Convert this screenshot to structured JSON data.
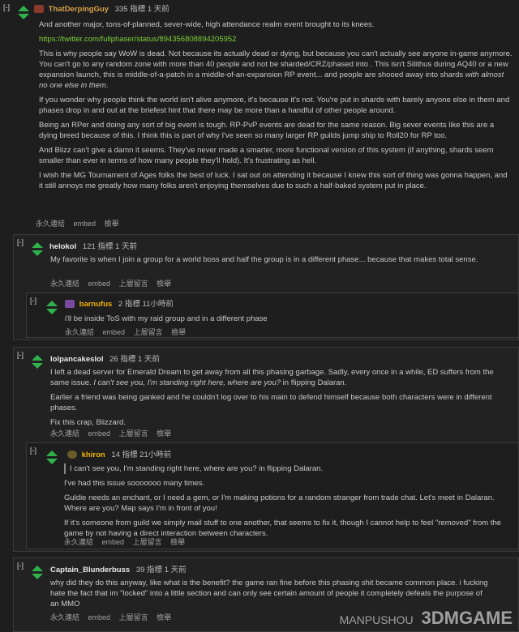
{
  "comments": {
    "top": {
      "collapse": "[-]",
      "author": "ThatDerpingGuy",
      "points": "335 指標",
      "time": "1 天前",
      "p1": "And another major, tons-of-planned, sever-wide, high attendance realm event brought to its knees.",
      "link": "https://twitter.com/fullphaser/status/894356808894205952",
      "p2a": "This is why people say WoW is dead. Not because its actually dead or dying, but because you can't actually see anyone in-game anymore. You can't go to any random zone with more than 40 people and not be sharded/CRZ/phased into . This isn't Silithus during AQ40 or a new expansion launch, this is middle-of-a-patch in a middle-of-an-expansion RP event... and people are shooed away into shards ",
      "p2em": "with almost no one else in them",
      "p2b": ".",
      "p3": "If you wonder why people think the world isn't alive anymore, it's because it's not. You're put in shards with barely anyone else in them and phases drop in and out at the briefest hint that there may be more than a handful of other people around.",
      "p4": "Being an RPer and doing any sort of big event is tough. RP-PvP events are dead for the same reason. Big sever events like this are a dying breed because of this. I think this is part of why I've seen so many larger RP guilds jump ship to Roll20 for RP too.",
      "p5": "And Blizz can't give a damn it seems. They've never made a smarter, more functional version of this system (if anything, shards seem smaller than ever in terms of how many people they'll hold). It's frustrating as hell.",
      "p6": "I wish the MG Tournament of Ages folks the best of luck. I sat out on attending it because I knew this sort of thing was gonna happen, and it still annoys me greatly how many folks aren't enjoying themselves due to such a half-baked system put in place.",
      "actions": [
        "永久連結",
        "embed",
        "檢舉"
      ]
    },
    "helokol": {
      "collapse": "[-]",
      "author": "helokol",
      "points": "121 指標",
      "time": "1 天前",
      "p1": "My favorite is when I join a group for a world boss and half the group is in a different phase... because that makes total sense.",
      "actions": [
        "永久連結",
        "embed",
        "上層留言",
        "檢舉"
      ]
    },
    "barnufus": {
      "collapse": "[-]",
      "author": "barnufus",
      "points": "2 指標",
      "time": "11小時前",
      "p1": "i'll be inside ToS with my raid group and in a different phase",
      "actions": [
        "永久連結",
        "embed",
        "上層留言",
        "檢舉"
      ]
    },
    "lol": {
      "collapse": "[-]",
      "author": "lolpancakeslol",
      "points": "26 指標",
      "time": "1 天前",
      "p1": "I left a dead server for Emerald Dream to get away from all this phasing garbage. Sadly, every once in a while, ED suffers from the same issue. ",
      "p1em": "I can't see you, I'm standing right here, where are you?",
      "p1b": " in flipping Dalaran.",
      "p2": "Earlier a friend was being ganked and he couldn't log over to his main to defend himself because both characters were in different phases.",
      "p3": "Fix this crap, Blizzard.",
      "actions": [
        "永久連結",
        "embed",
        "上層留言",
        "檢舉"
      ]
    },
    "khiron": {
      "collapse": "[-]",
      "author": "khiron",
      "points": "14 指標",
      "time": "21小時前",
      "quote": "I can't see you, I'm standing right here, where are you? in flipping Dalaran.",
      "p1": "I've had this issue sooooooo many times.",
      "p2": "Guldie needs an enchant, or I need a gem, or I'm making potions for a random stranger from trade chat. Let's meet in Dalaran. Where are you? Map says I'm in front of you!",
      "p3": "If it's someone from guild we simply mail stuff to one another, that seems to fix it, though I cannot help to feel \"removed\" from the game by not having a direct interaction between characters.",
      "actions": [
        "永久連結",
        "embed",
        "上層留言",
        "檢舉"
      ]
    },
    "captain": {
      "collapse": "[-]",
      "author": "Captain_Blunderbuss",
      "points": "39 指標",
      "time": "1 天前",
      "p1": "why did they do this anyway, like what is the benefit? the game ran fine before this phasing shit became common place. i fucking hate the fact that im \"locked\" into a little section and can only see certain amount of people it completely defeats the purpose of an MMO",
      "actions": [
        "永久連結",
        "embed",
        "上層留言",
        "檢舉"
      ]
    }
  },
  "watermark": {
    "text": "MANPUSHOU",
    "brand": "3DMGAME"
  },
  "colors": {
    "vote": "#2fb24b",
    "link": "#7ad03a",
    "background": "#1e1e1e"
  }
}
